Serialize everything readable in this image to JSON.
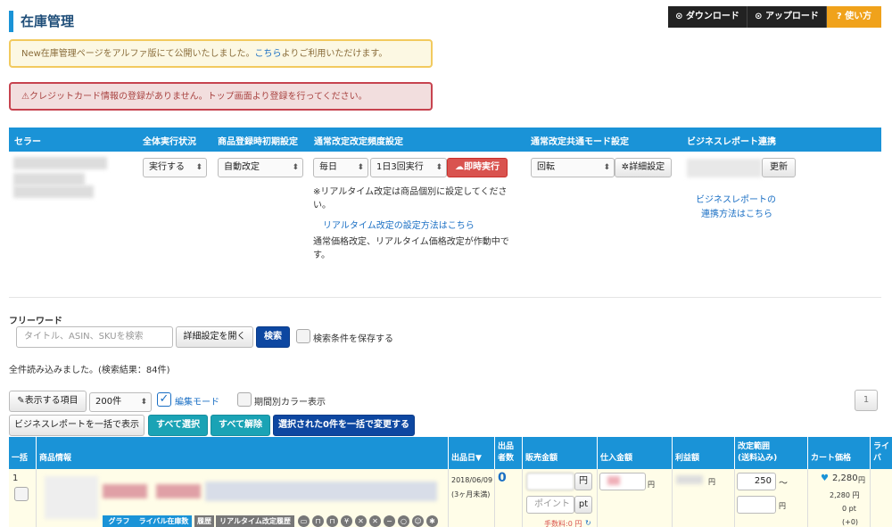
{
  "page_title": "在庫管理",
  "top_buttons": {
    "download": "ダウンロード",
    "upload": "アップロード",
    "help": "使い方"
  },
  "notice": {
    "text_before": "New在庫管理ページをアルファ版にて公開いたしました。",
    "link": "こちら",
    "text_after": "よりご利用いただけます。"
  },
  "error_text": "クレジットカード情報の登録がありません。トップ画面より登録を行ってください。",
  "settings": {
    "headers": {
      "seller": "セラー",
      "all_exec": "全体実行状況",
      "initial": "商品登録時初期設定",
      "frequency": "通常改定改定頻度設定",
      "common_mode": "通常改定共通モード設定",
      "biz_report": "ビジネスレポート連携"
    },
    "all_exec_value": "実行する",
    "initial_value": "自動改定",
    "freq_value": "毎日",
    "times_value": "1日3回実行",
    "run_now": "即時実行",
    "mode_value": "回転",
    "detail_settings": "詳細設定",
    "update": "更新",
    "realtime_note": "※リアルタイム改定は商品個別に設定してください。",
    "realtime_link": "リアルタイム改定の設定方法はこちら",
    "status_note": "通常価格改定、リアルタイム価格改定が作動中です。",
    "biz_link_1": "ビジネスレポートの",
    "biz_link_2": "連携方法はこちら"
  },
  "search": {
    "label": "フリーワード",
    "placeholder": "タイトル、ASIN、SKUを検索",
    "advanced": "詳細設定を開く",
    "submit": "検索",
    "save_conditions": "検索条件を保存する",
    "result": "全件読み込みました。(検索結果：84件)"
  },
  "toolbar": {
    "display_items": "表示する項目",
    "per_page": "200件",
    "edit_mode": "編集モード",
    "period_color": "期間別カラー表示",
    "page": "1",
    "biz_bulk": "ビジネスレポートを一括で表示",
    "select_all": "すべて選択",
    "deselect_all": "すべて解除",
    "bulk_change": "選択された0件を一括で変更する"
  },
  "table": {
    "headers": {
      "bulk": "一括",
      "product": "商品情報",
      "date": "出品日▼",
      "sellers": "出品\n者数",
      "sale_price": "販売金額",
      "purchase": "仕入金額",
      "profit": "利益額",
      "range": "改定範囲\n(送料込み)",
      "cart": "カート価格",
      "rival": "ライバ"
    },
    "row": {
      "index": "1",
      "date": "2018/06/09",
      "date_sub": "(3ヶ月未満)",
      "sellers": "0",
      "yen": "円",
      "point_placeholder": "ポイント",
      "pt": "pt",
      "fee": "手数料:0 円",
      "range_min": "250",
      "tilde": "〜",
      "cart_price": "2,280",
      "cart_sub_price": "2,280 円",
      "cart_points": "0 pt",
      "cart_delta": "(+0)",
      "tags": {
        "graph": "グラフ",
        "rival_stock": "ライバル在庫数",
        "history": "履歴",
        "rt_history": "リアルタイム改定履歴"
      }
    }
  },
  "colors": {
    "primary": "#1a93d7",
    "navy": "#0d47a1",
    "teal": "#1aa3b5",
    "danger": "#d9534f",
    "warning": "#f0a21b"
  },
  "icons": [
    "download-icon",
    "upload-icon",
    "help-icon",
    "warning-icon",
    "cloud-upload-icon",
    "gear-icon",
    "pencil-icon",
    "check-icon",
    "heart-icon",
    "refresh-icon"
  ]
}
